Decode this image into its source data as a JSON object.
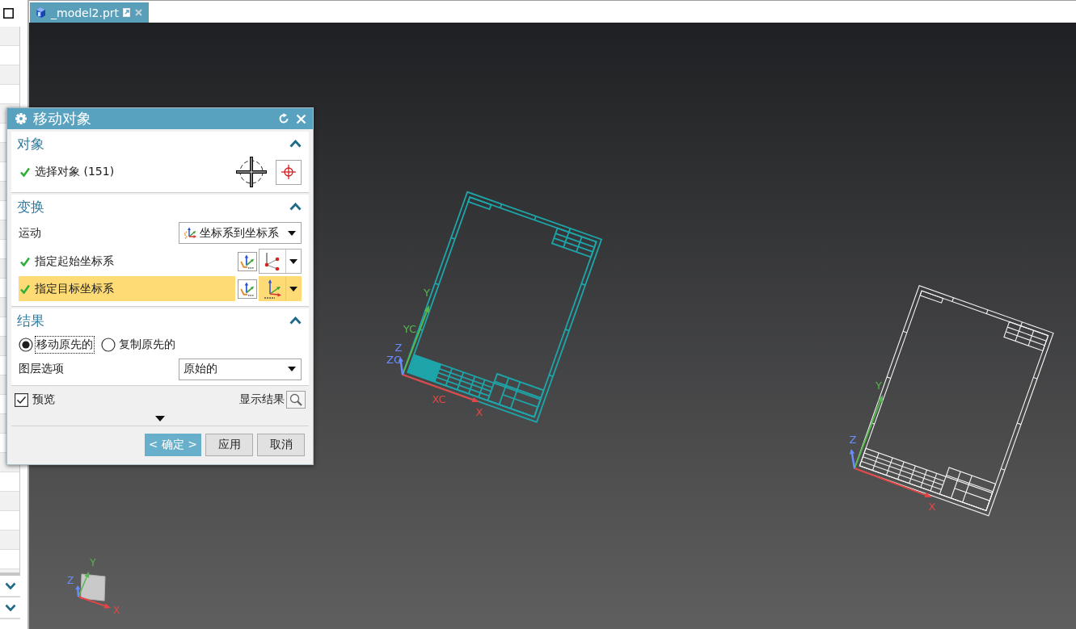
{
  "tabs": [
    {
      "label": "_model2.prt",
      "selected": true
    }
  ],
  "dialog": {
    "title": "移动对象",
    "sections": [
      {
        "title": "对象",
        "expanded": true,
        "rows": [
          {
            "kind": "select",
            "label": "选择对象 (151)",
            "complete": true
          }
        ]
      },
      {
        "title": "变换",
        "expanded": true,
        "rows": [
          {
            "kind": "dropdown",
            "label": "运动",
            "value": "坐标系到坐标系",
            "has_icon": true
          },
          {
            "kind": "csys",
            "label": "指定起始坐标系",
            "complete": true,
            "selected": false
          },
          {
            "kind": "csys",
            "label": "指定目标坐标系",
            "complete": true,
            "selected": true
          }
        ]
      },
      {
        "title": "结果",
        "expanded": true,
        "rows": [
          {
            "kind": "radio",
            "options": [
              {
                "label": "移动原先的",
                "selected": true
              },
              {
                "label": "复制原先的",
                "selected": false
              }
            ]
          },
          {
            "kind": "dropdown",
            "label": "图层选项",
            "value": "原始的",
            "has_icon": false
          }
        ]
      }
    ],
    "preview": {
      "label": "预览",
      "checked": true
    },
    "show_result": {
      "label": "显示结果"
    },
    "buttons": [
      {
        "label": "< 确定 >",
        "kind": "primary"
      },
      {
        "label": "应用",
        "kind": "normal"
      },
      {
        "label": "取消",
        "kind": "normal"
      }
    ]
  },
  "viewport": {
    "sheets": [
      {
        "kind": "preview",
        "labels": {
          "y": "Y",
          "yc": "YC",
          "z": "Z",
          "zc": "ZC",
          "xc": "XC",
          "x": "X"
        }
      },
      {
        "kind": "original",
        "labels": {
          "y": "Y",
          "z": "Z",
          "x": "X"
        }
      }
    ],
    "view_triad": {
      "labels": {
        "y": "Y",
        "z": "Z",
        "x": "X"
      }
    }
  }
}
